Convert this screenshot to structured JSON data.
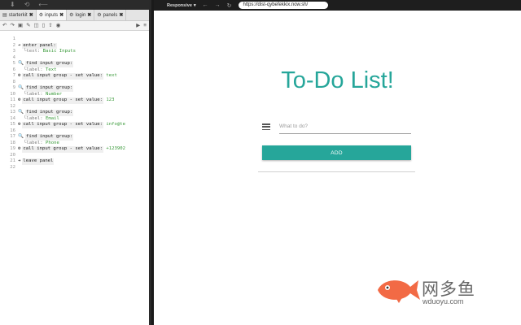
{
  "left": {
    "tabs": [
      {
        "label": "starterkit",
        "close": "✖"
      },
      {
        "label": "inputs",
        "close": "✖"
      },
      {
        "label": "login",
        "close": "✖"
      },
      {
        "label": "panels",
        "close": "✖"
      }
    ],
    "line_numbers": [
      "1",
      "2",
      "3",
      "4",
      "5",
      "6",
      "7",
      "8",
      "9",
      "10",
      "11",
      "12",
      "13",
      "14",
      "15",
      "16",
      "17",
      "18",
      "19",
      "20",
      "21",
      "22"
    ],
    "code": {
      "l2_cmd": "enter panel:",
      "l3_sub": "text:",
      "l3_val": "Basic Inputs",
      "l5_cmd": "find input group:",
      "l6_sub": "label:",
      "l6_val": "Text",
      "l7_cmd": "call input group - set value:",
      "l7_val": "text",
      "l9_cmd": "find input group:",
      "l10_sub": "label:",
      "l10_val": "Number",
      "l11_cmd": "call input group - set value:",
      "l11_val": "123",
      "l13_cmd": "find input group:",
      "l14_sub": "label:",
      "l14_val": "Email",
      "l15_cmd": "call input group - set value:",
      "l15_val": "info@te",
      "l17_cmd": "find input group:",
      "l18_sub": "label:",
      "l18_val": "Phone",
      "l19_cmd": "call input group - set value:",
      "l19_val": "+123902",
      "l21_cmd": "leave panel"
    }
  },
  "browser": {
    "device": "Responsive",
    "url": "https://dist-qybefekkix.now.sh/"
  },
  "app": {
    "title": "To-Do List!",
    "placeholder": "What to do?",
    "add_label": "ADD"
  },
  "watermark": {
    "text": "网多鱼",
    "url": "wduoyu.com"
  },
  "colors": {
    "accent": "#26a69a",
    "value_green": "#3a9a3a"
  }
}
